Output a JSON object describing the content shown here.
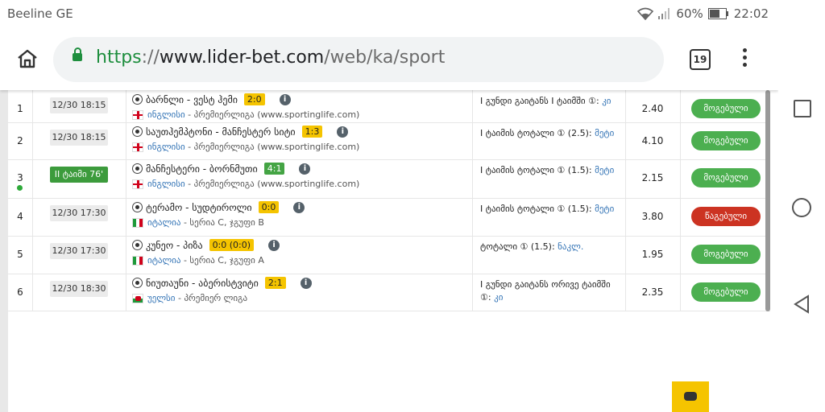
{
  "status_bar": {
    "carrier": "Beeline GE",
    "battery": "60%",
    "time": "22:02"
  },
  "browser": {
    "url_scheme": "https",
    "url_sep": "://",
    "url_host": "www.lider-bet.com",
    "url_path": "/web/ka/sport",
    "tab_count": "19"
  },
  "bets": [
    {
      "num": "1",
      "time": "12/30 18:15",
      "live": false,
      "match": "ბარნლი - ვესტ ჰემი",
      "score": "2:0",
      "score_live": false,
      "flag": "eng",
      "country": "ინგლისი",
      "league": " - პრემიერლიგა (www.sportinglife.com)",
      "market": "I გუნდი გაიტანს I ტაიმში ①:",
      "pick": "კი",
      "odds": "2.40",
      "status": "მოგებული",
      "won": true
    },
    {
      "num": "2",
      "time": "12/30 18:15",
      "live": false,
      "match": "საუთჰემპტონი - მანჩესტერ სიტი",
      "score": "1:3",
      "score_live": false,
      "flag": "eng",
      "country": "ინგლისი",
      "league": " - პრემიერლიგა (www.sportinglife.com)",
      "market": "I ტაიმის ტოტალი ① (2.5):",
      "pick": "მეტი",
      "odds": "4.10",
      "status": "მოგებული",
      "won": true
    },
    {
      "num": "3",
      "time": "II ტაიმი 76'",
      "live": true,
      "match": "მანჩესტერი - ბორნმუთი",
      "score": "4:1",
      "score_live": true,
      "flag": "eng",
      "country": "ინგლისი",
      "league": " - პრემიერლიგა (www.sportinglife.com)",
      "market": "I ტაიმის ტოტალი ① (1.5):",
      "pick": "მეტი",
      "odds": "2.15",
      "status": "მოგებული",
      "won": true
    },
    {
      "num": "4",
      "time": "12/30 17:30",
      "live": false,
      "match": "ტერამო - სუდტიროლი",
      "score": "0:0",
      "score_live": false,
      "flag": "ita",
      "country": "იტალია",
      "league": " - სერია C, ჯგუფი B",
      "market": "I ტაიმის ტოტალი ① (1.5):",
      "pick": "მეტი",
      "odds": "3.80",
      "status": "წაგებული",
      "won": false
    },
    {
      "num": "5",
      "time": "12/30 17:30",
      "live": false,
      "match": "კუნეო - პიზა",
      "score": "0:0 (0:0)",
      "score_live": false,
      "flag": "ita",
      "country": "იტალია",
      "league": " - სერია C, ჯგუფი A",
      "market": "ტოტალი ① (1.5): ",
      "pick": "ნაკლ.",
      "odds": "1.95",
      "status": "მოგებული",
      "won": true
    },
    {
      "num": "6",
      "time": "12/30 18:30",
      "live": false,
      "match": "ნიუთაუნი - აბერისტვიტი",
      "score": "2:1",
      "score_live": false,
      "flag": "wal",
      "country": "უელსი",
      "league": " - პრემიერ ლიგა",
      "market": "I გუნდი გაიტანს ორივე ტაიმში ①: ",
      "pick": "კი",
      "odds": "2.35",
      "status": "მოგებული",
      "won": true
    }
  ],
  "colors": {
    "won": "#4caf50",
    "lost": "#cc3322",
    "score": "#f5c400",
    "live": "#3c9b3c"
  }
}
